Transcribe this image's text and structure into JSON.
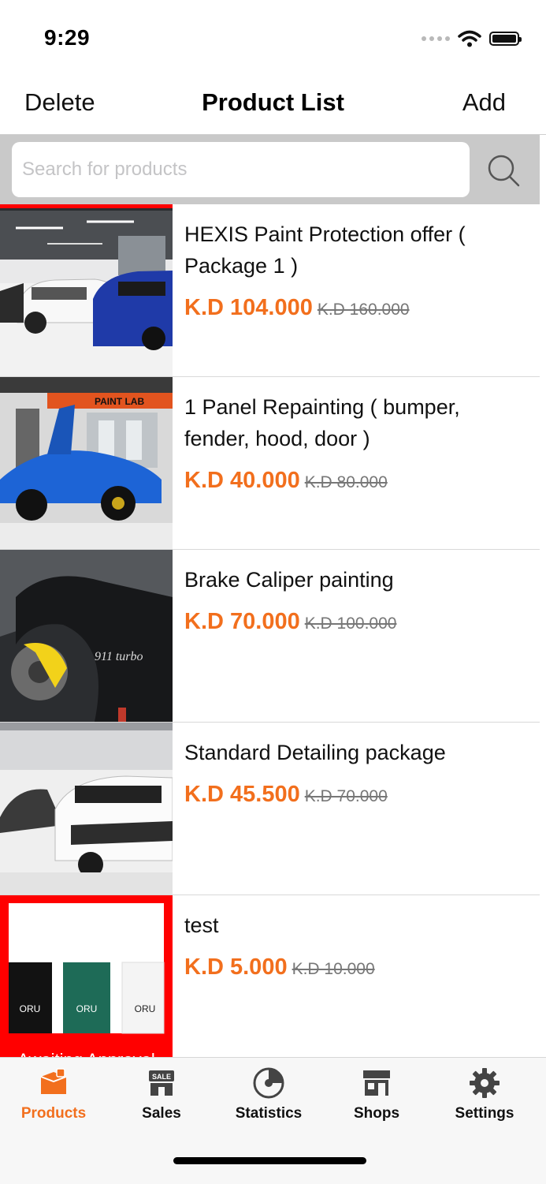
{
  "status_bar": {
    "time": "9:29"
  },
  "nav": {
    "left": "Delete",
    "title": "Product List",
    "right": "Add"
  },
  "search": {
    "placeholder": "Search for products",
    "icon": "search-icon"
  },
  "products": [
    {
      "title": "HEXIS Paint Protection offer ( Package 1 )",
      "price": "K.D 104.000",
      "old_price": "K.D 160.000",
      "image": "garage-cars"
    },
    {
      "title": "1 Panel Repainting ( bumper, fender, hood, door )",
      "price": "K.D 40.000",
      "old_price": "K.D 80.000",
      "image": "blue-lamborghini-paint-lab",
      "image_sign": "PAINT LAB"
    },
    {
      "title": "Brake Caliper painting",
      "price": "K.D 70.000",
      "old_price": "K.D 100.000",
      "image": "yellow-caliper",
      "image_text": "911 turbo"
    },
    {
      "title": "Standard Detailing package",
      "price": "K.D 45.500",
      "old_price": "K.D 70.000",
      "image": "white-urus"
    },
    {
      "title": "test",
      "price": "K.D 5.000",
      "old_price": "K.D 10.000",
      "image": "oru-pouches",
      "image_brand": "ORU",
      "status": "Awaiting Approval",
      "status_color": "#ff0000"
    }
  ],
  "tabs": [
    {
      "label": "Products",
      "icon": "products-box-icon",
      "active": true
    },
    {
      "label": "Sales",
      "icon": "sale-store-icon",
      "active": false
    },
    {
      "label": "Statistics",
      "icon": "statistics-disc-icon",
      "active": false
    },
    {
      "label": "Shops",
      "icon": "shop-storefront-icon",
      "active": false
    },
    {
      "label": "Settings",
      "icon": "gear-icon",
      "active": false
    }
  ],
  "colors": {
    "accent": "#f26f1d",
    "search_bar_bg": "#c9c9c9",
    "status_flag": "#ff0000"
  }
}
